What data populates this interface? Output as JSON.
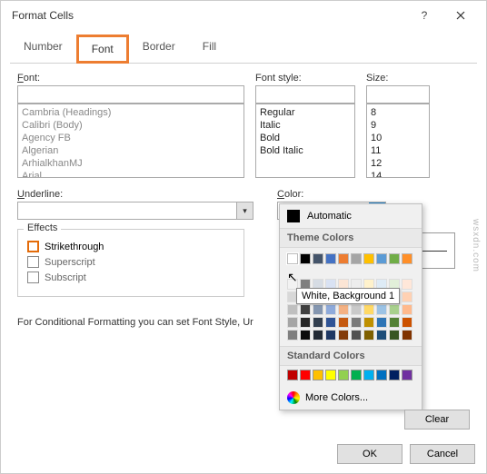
{
  "titlebar": {
    "title": "Format Cells"
  },
  "tabs": {
    "number": "Number",
    "font": "Font",
    "border": "Border",
    "fill": "Fill"
  },
  "font": {
    "label": "Font:",
    "items": [
      "Cambria (Headings)",
      "Calibri (Body)",
      "Agency FB",
      "Algerian",
      "ArhialkhanMJ",
      "Arial"
    ]
  },
  "style": {
    "label": "Font style:",
    "items": [
      "Regular",
      "Italic",
      "Bold",
      "Bold Italic"
    ]
  },
  "size": {
    "label": "Size:",
    "items": [
      "8",
      "9",
      "10",
      "11",
      "12",
      "14"
    ]
  },
  "underline": {
    "label": "Underline:"
  },
  "color": {
    "label": "Color:",
    "value": "Automatic"
  },
  "effects": {
    "legend": "Effects",
    "strike": "Strikethrough",
    "super": "Superscript",
    "sub": "Subscript"
  },
  "note": "For Conditional Formatting you can set Font Style, Ur",
  "buttons": {
    "clear": "Clear",
    "ok": "OK",
    "cancel": "Cancel"
  },
  "picker": {
    "auto": "Automatic",
    "theme": "Theme Colors",
    "standard": "Standard Colors",
    "more": "More Colors...",
    "tooltip": "White, Background 1",
    "theme_row1": [
      "#ffffff",
      "#000000",
      "#44546a",
      "#4472c4",
      "#ed7d31",
      "#a5a5a5",
      "#ffc000",
      "#5b9bd5",
      "#70ad47",
      "#ff8f28"
    ],
    "theme_shades": [
      [
        "#f2f2f2",
        "#7f7f7f",
        "#d6dce4",
        "#d9e2f3",
        "#fbe5d5",
        "#ededed",
        "#fff2cc",
        "#deebf6",
        "#e2efd9",
        "#ffe7d9"
      ],
      [
        "#d8d8d8",
        "#595959",
        "#adb9ca",
        "#b4c6e7",
        "#f7cbac",
        "#dbdbdb",
        "#fee599",
        "#bdd7ee",
        "#c5e0b3",
        "#ffd1b3"
      ],
      [
        "#bfbfbf",
        "#3f3f3f",
        "#8496b0",
        "#8eaadb",
        "#f4b183",
        "#c9c9c9",
        "#ffd965",
        "#9cc3e5",
        "#a8d08d",
        "#ffb98c"
      ],
      [
        "#a5a5a5",
        "#262626",
        "#323f4f",
        "#2f5496",
        "#c55a11",
        "#7b7b7b",
        "#bf9000",
        "#2e75b5",
        "#538135",
        "#cc5200"
      ],
      [
        "#7f7f7f",
        "#0c0c0c",
        "#222a35",
        "#1f3864",
        "#833c0b",
        "#525252",
        "#7f6000",
        "#1e4e79",
        "#375623",
        "#803300"
      ]
    ],
    "standard_colors": [
      "#c00000",
      "#ff0000",
      "#ffc000",
      "#ffff00",
      "#92d050",
      "#00b050",
      "#00b0f0",
      "#0070c0",
      "#002060",
      "#7030a0"
    ]
  },
  "watermark": "wsxdn.com"
}
